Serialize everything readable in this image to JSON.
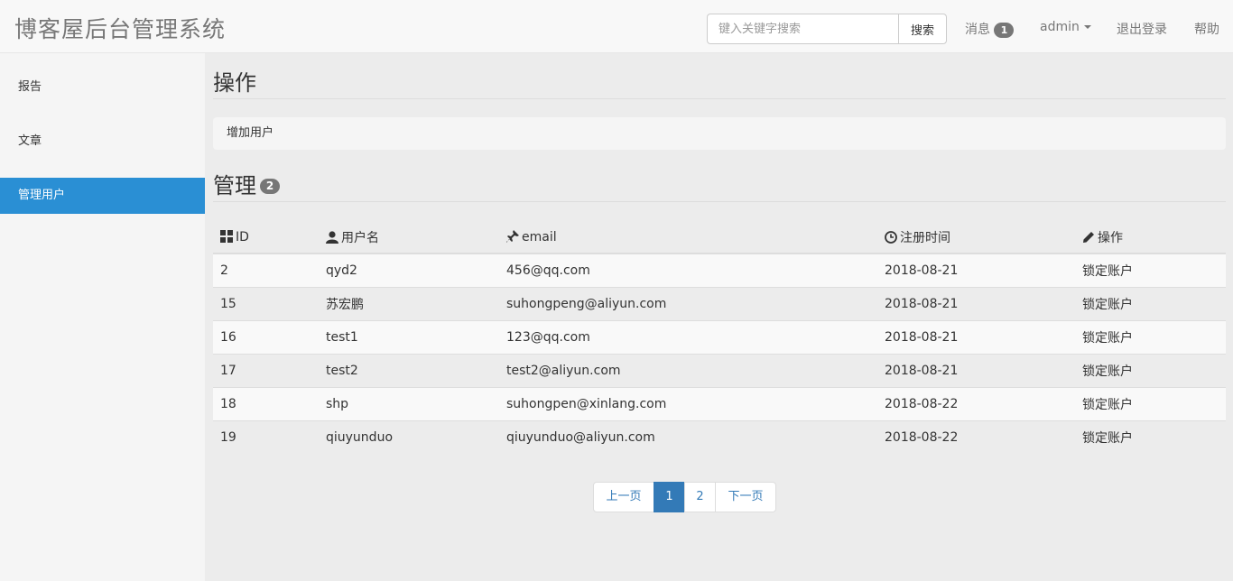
{
  "header": {
    "brand": "博客屋后台管理系统",
    "search": {
      "placeholder": "键入关键字搜索",
      "value": "",
      "button_label": "搜索"
    },
    "messages_label": "消息",
    "messages_count": "1",
    "user_label": "admin",
    "logout_label": "退出登录",
    "help_label": "帮助"
  },
  "sidebar": {
    "items": [
      {
        "label": "报告",
        "active": false
      },
      {
        "label": "文章",
        "active": false
      },
      {
        "label": "管理用户",
        "active": true
      }
    ],
    "active_color": "#2a8fd4"
  },
  "main": {
    "operations_title": "操作",
    "add_user_label": "增加用户",
    "manage_title": "管理",
    "manage_count": "2",
    "table": {
      "columns": [
        {
          "label": "ID",
          "icon": "grid-icon"
        },
        {
          "label": "用户名",
          "icon": "user-icon"
        },
        {
          "label": "email",
          "icon": "pin-icon"
        },
        {
          "label": "注册时间",
          "icon": "clock-icon"
        },
        {
          "label": "操作",
          "icon": "pencil-icon"
        }
      ],
      "rows": [
        {
          "id": "2",
          "username": "qyd2",
          "email": "456@qq.com",
          "registered": "2018-08-21",
          "action": "锁定账户"
        },
        {
          "id": "15",
          "username": "苏宏鹏",
          "email": "suhongpeng@aliyun.com",
          "registered": "2018-08-21",
          "action": "锁定账户"
        },
        {
          "id": "16",
          "username": "test1",
          "email": "123@qq.com",
          "registered": "2018-08-21",
          "action": "锁定账户"
        },
        {
          "id": "17",
          "username": "test2",
          "email": "test2@aliyun.com",
          "registered": "2018-08-21",
          "action": "锁定账户"
        },
        {
          "id": "18",
          "username": "shp",
          "email": "suhongpen@xinlang.com",
          "registered": "2018-08-22",
          "action": "锁定账户"
        },
        {
          "id": "19",
          "username": "qiuyunduo",
          "email": "qiuyunduo@aliyun.com",
          "registered": "2018-08-22",
          "action": "锁定账户"
        }
      ]
    },
    "pagination": {
      "prev_label": "上一页",
      "pages": [
        "1",
        "2"
      ],
      "current": "1",
      "next_label": "下一页",
      "accent": "#337ab7"
    }
  }
}
